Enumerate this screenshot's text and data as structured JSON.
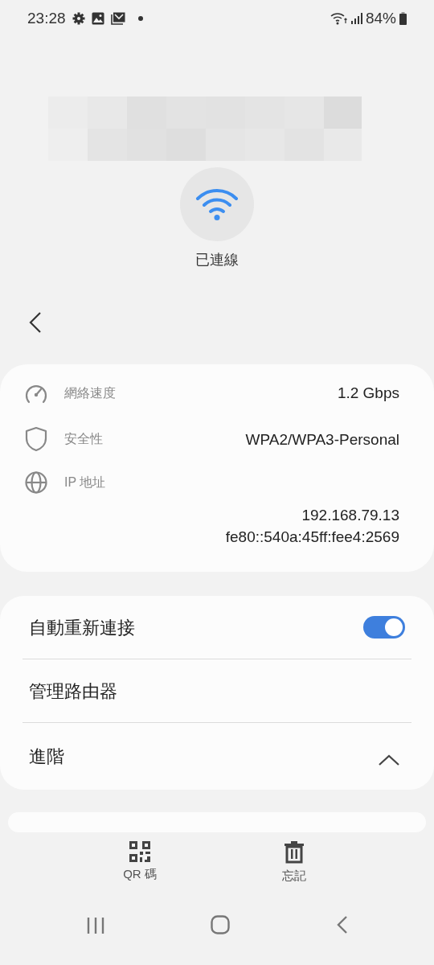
{
  "status_bar": {
    "time": "23:28",
    "battery": "84%"
  },
  "connection": {
    "status": "已連線"
  },
  "details": [
    {
      "kind": "speed",
      "label": "網絡速度",
      "values": [
        "1.2 Gbps"
      ]
    },
    {
      "kind": "shield",
      "label": "安全性",
      "values": [
        "WPA2/WPA3-Personal"
      ]
    },
    {
      "kind": "globe",
      "label": "IP 地址",
      "values": [
        "192.168.79.13",
        "fe80::540a:45ff:fee4:2569"
      ]
    }
  ],
  "settings": [
    {
      "kind": "toggle",
      "label": "自動重新連接",
      "on": true
    },
    {
      "kind": "link",
      "label": "管理路由器"
    },
    {
      "kind": "expander",
      "label": "進階",
      "expanded": true
    }
  ],
  "actions": [
    {
      "kind": "qr",
      "label": "QR 碼"
    },
    {
      "kind": "trash",
      "label": "忘記"
    }
  ]
}
